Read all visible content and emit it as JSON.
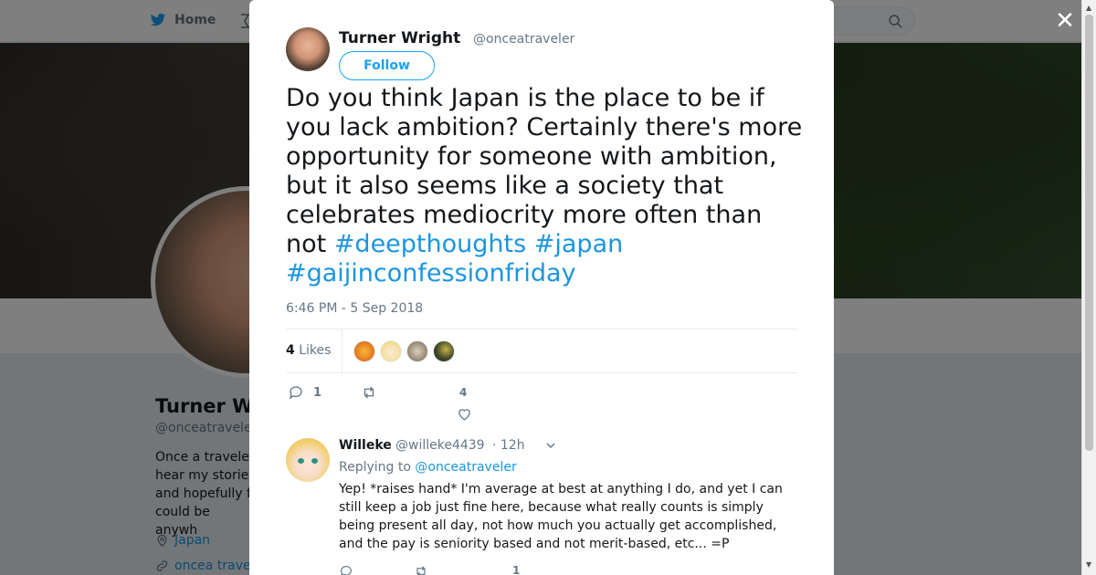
{
  "nav": {
    "home_label": "Home"
  },
  "profile": {
    "name": "Turner W",
    "handle": "@onceatravele",
    "bio": "Once a travele\nhear my storie\nand hopefully f\ncould be anywh",
    "location": "Japan",
    "link": "oncea traveler"
  },
  "tweet": {
    "author_name": "Turner Wright",
    "author_handle": "@onceatraveler",
    "follow_label": "Follow",
    "text": "Do you think Japan is the place to be if you lack ambition? Certainly there's more opportunity for someone with ambition, but it also seems like a society that celebrates mediocrity more often than not ",
    "hashtags": [
      "#deepthoughts",
      "#japan",
      "#gaijinconfessionfriday"
    ],
    "timestamp": "6:46 PM - 5 Sep 2018",
    "likes_count": "4",
    "likes_label": "Likes",
    "reply_count": "1",
    "like_count": "4"
  },
  "reply": {
    "author_name": "Willeke",
    "author_handle": "@willeke4439",
    "time": "· 12h",
    "replying_prefix": "Replying to",
    "replying_to": "@onceatraveler",
    "text": "Yep! *raises hand* I'm average at best at anything I do, and yet I can still keep a job just fine here, because what really counts is simply being present all day, not how much you actually get accomplished, and the pay is seniority based and not merit-based, etc... =P",
    "like_count": "1"
  },
  "icons": {
    "twitter": "twitter-bird-icon",
    "search": "search-icon",
    "close": "close-icon",
    "reply": "reply-icon",
    "retweet": "retweet-icon",
    "like": "heart-icon",
    "chevron": "chevron-down-icon",
    "location": "location-pin-icon",
    "link": "link-icon"
  },
  "colors": {
    "accent": "#1da1f2",
    "link": "#1b95e0",
    "muted": "#657786"
  }
}
